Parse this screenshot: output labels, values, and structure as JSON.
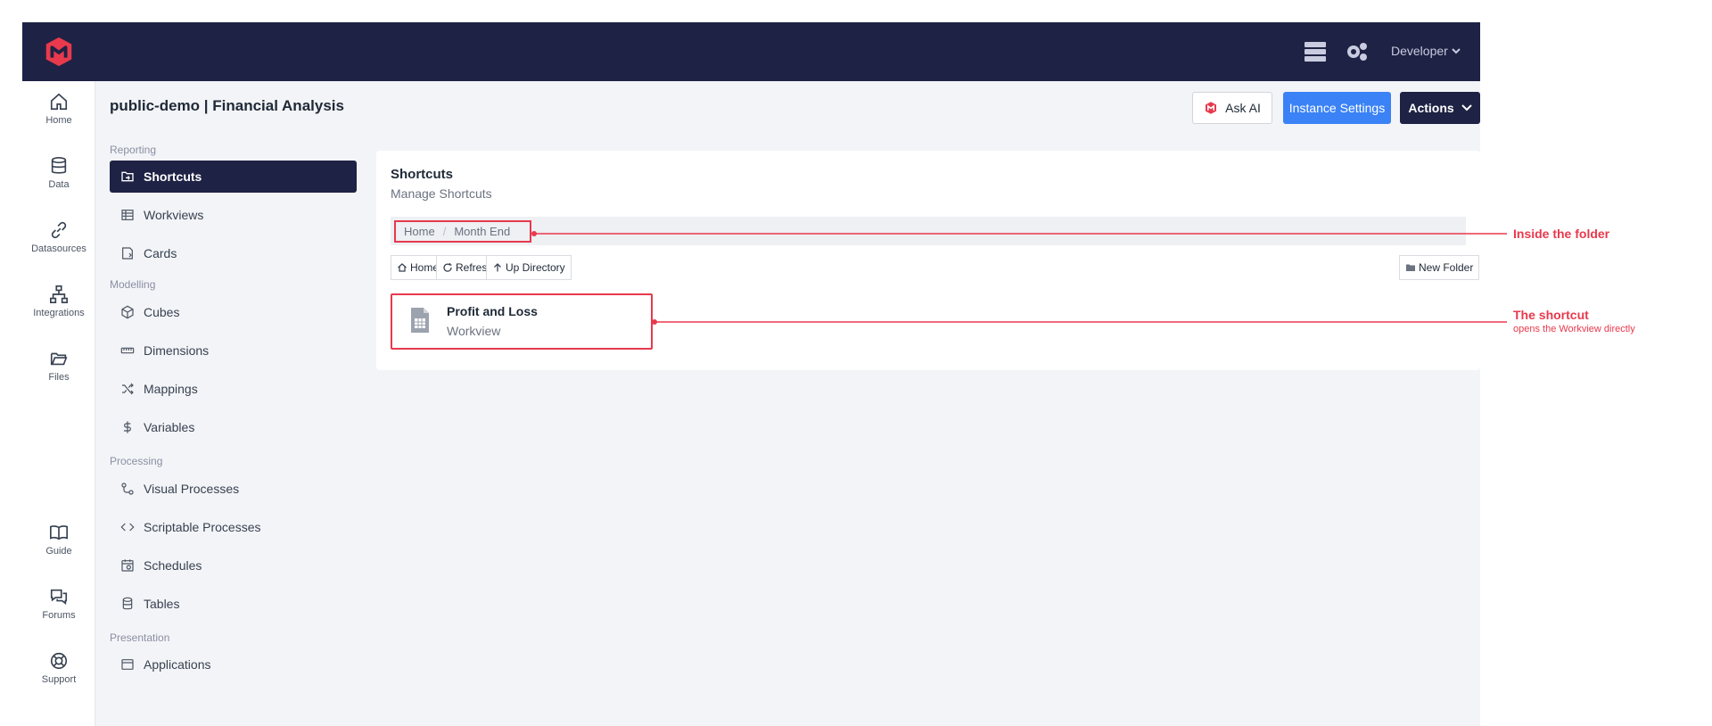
{
  "topbar": {
    "user_label": "Developer"
  },
  "rail": {
    "items": [
      {
        "label": "Home"
      },
      {
        "label": "Data"
      },
      {
        "label": "Datasources"
      },
      {
        "label": "Integrations"
      },
      {
        "label": "Files"
      },
      {
        "label": "Guide"
      },
      {
        "label": "Forums"
      },
      {
        "label": "Support"
      }
    ]
  },
  "page": {
    "title": "public-demo | Financial Analysis"
  },
  "header_buttons": {
    "ask_ai": "Ask AI",
    "instance_settings": "Instance Settings",
    "actions": "Actions"
  },
  "subnav": {
    "sections": [
      {
        "label": "Reporting",
        "items": [
          {
            "label": "Shortcuts"
          },
          {
            "label": "Workviews"
          },
          {
            "label": "Cards"
          }
        ]
      },
      {
        "label": "Modelling",
        "items": [
          {
            "label": "Cubes"
          },
          {
            "label": "Dimensions"
          },
          {
            "label": "Mappings"
          },
          {
            "label": "Variables"
          }
        ]
      },
      {
        "label": "Processing",
        "items": [
          {
            "label": "Visual Processes"
          },
          {
            "label": "Scriptable Processes"
          },
          {
            "label": "Schedules"
          },
          {
            "label": "Tables"
          }
        ]
      },
      {
        "label": "Presentation",
        "items": [
          {
            "label": "Applications"
          }
        ]
      }
    ],
    "active": "Shortcuts"
  },
  "panel": {
    "title": "Shortcuts",
    "subtitle": "Manage Shortcuts",
    "breadcrumb": [
      "Home",
      "Month End"
    ],
    "toolbar": {
      "home": "Home",
      "refresh": "Refresh",
      "up": "Up Directory",
      "new_folder": "New Folder"
    },
    "shortcut": {
      "name": "Profit and Loss",
      "type": "Workview"
    }
  },
  "annotations": {
    "folder": {
      "title": "Inside the folder"
    },
    "shortcut": {
      "title": "The shortcut",
      "subtitle": "opens the Workview directly"
    }
  },
  "colors": {
    "navy": "#1e2244",
    "accent_red": "#e8394d",
    "primary_blue": "#3b82f6"
  }
}
